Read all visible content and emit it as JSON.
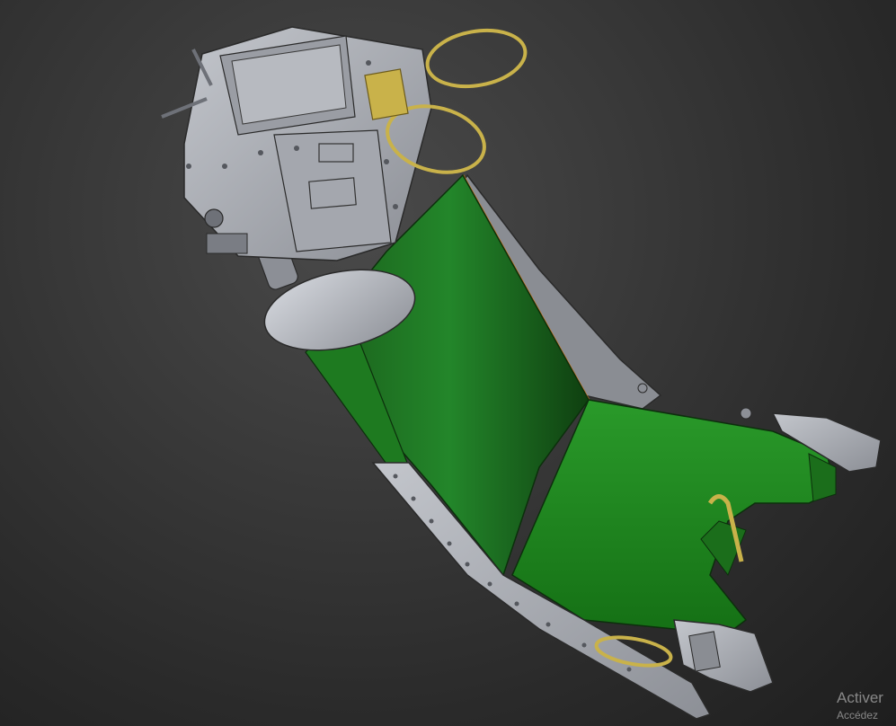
{
  "scene": {
    "colors": {
      "background": "#2e2e2e",
      "metal": "#a9acb3",
      "metal_dark": "#6e7178",
      "cushion_green": "#1f7a1f",
      "cushion_green_dark": "#145214",
      "brass": "#c9b24a",
      "edge_orange": "#e07a1a"
    }
  },
  "watermark": {
    "line1": "Activer",
    "line2": "Accédez"
  }
}
